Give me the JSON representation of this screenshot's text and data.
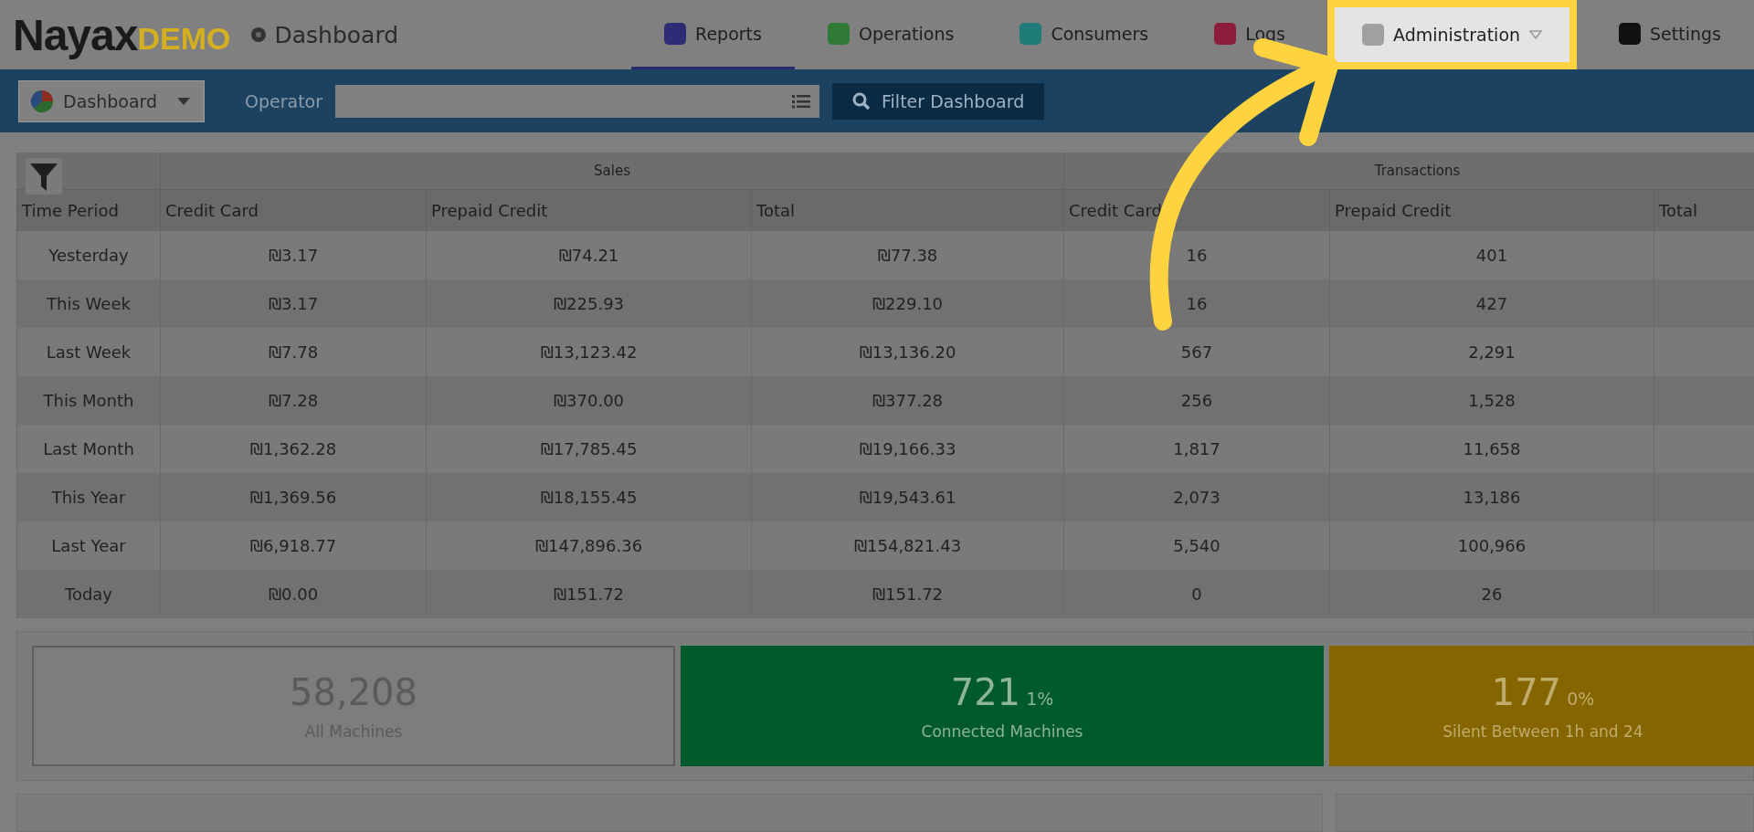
{
  "header": {
    "logo": "Nayax",
    "logo_suffix": "DEMO",
    "page_title": "Dashboard"
  },
  "nav": [
    {
      "label": "Reports",
      "selected": true,
      "highlighted": false,
      "dropdown": false,
      "color": "#2e2c74"
    },
    {
      "label": "Operations",
      "selected": false,
      "highlighted": false,
      "dropdown": false,
      "color": "#2f7a34"
    },
    {
      "label": "Consumers",
      "selected": false,
      "highlighted": false,
      "dropdown": false,
      "color": "#1e7b78"
    },
    {
      "label": "Logs",
      "selected": false,
      "highlighted": false,
      "dropdown": false,
      "color": "#8c1d3c"
    },
    {
      "label": "Administration",
      "selected": false,
      "highlighted": true,
      "dropdown": true,
      "color": "#a0a0a0"
    },
    {
      "label": "Settings",
      "selected": false,
      "highlighted": false,
      "dropdown": false,
      "color": "#111111"
    }
  ],
  "toolbar": {
    "view": "Dashboard",
    "operator_label": "Operator",
    "filter_button": "Filter Dashboard"
  },
  "table": {
    "groups": [
      "Sales",
      "Transactions"
    ],
    "columns": [
      "Time Period",
      "Credit Card",
      "Prepaid Credit",
      "Total",
      "Credit Card",
      "Prepaid Credit",
      "Total"
    ],
    "rows": [
      [
        "Yesterday",
        "₪3.17",
        "₪74.21",
        "₪77.38",
        "16",
        "401"
      ],
      [
        "This Week",
        "₪3.17",
        "₪225.93",
        "₪229.10",
        "16",
        "427"
      ],
      [
        "Last Week",
        "₪7.78",
        "₪13,123.42",
        "₪13,136.20",
        "567",
        "2,291"
      ],
      [
        "This Month",
        "₪7.28",
        "₪370.00",
        "₪377.28",
        "256",
        "1,528"
      ],
      [
        "Last Month",
        "₪1,362.28",
        "₪17,785.45",
        "₪19,166.33",
        "1,817",
        "11,658"
      ],
      [
        "This Year",
        "₪1,369.56",
        "₪18,155.45",
        "₪19,543.61",
        "2,073",
        "13,186"
      ],
      [
        "Last Year",
        "₪6,918.77",
        "₪147,896.36",
        "₪154,821.43",
        "5,540",
        "100,966"
      ],
      [
        "Today",
        "₪0.00",
        "₪151.72",
        "₪151.72",
        "0",
        "26"
      ]
    ]
  },
  "cards": [
    {
      "value": "58,208",
      "label": "All Machines",
      "color": "#7d7d7d"
    },
    {
      "value": "721",
      "percent": "1%",
      "label": "Connected Machines",
      "color": "#005a2b"
    },
    {
      "value": "177",
      "percent": "0%",
      "label": "Silent Between 1h and 24",
      "color": "#856500"
    }
  ]
}
